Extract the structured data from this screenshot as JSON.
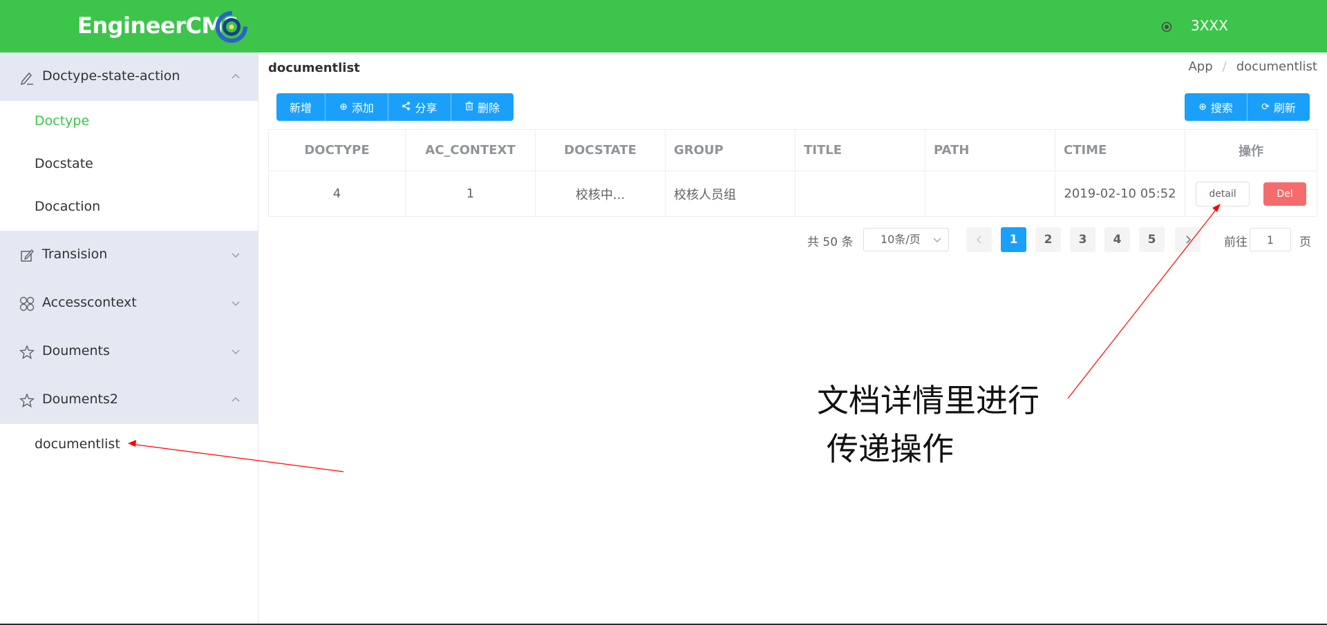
{
  "header": {
    "app_name": "EngineerCMS",
    "user_name": "3XXX",
    "brand_color": "#3cc54a"
  },
  "sidebar": {
    "groups": [
      {
        "label": "Doctype-state-action",
        "icon": "edit-pen-icon",
        "expanded": true
      },
      {
        "label": "Transision",
        "icon": "edit-square-icon",
        "expanded": false
      },
      {
        "label": "Accesscontext",
        "icon": "grid-circles-icon",
        "expanded": false
      },
      {
        "label": "Douments",
        "icon": "star-icon",
        "expanded": false
      },
      {
        "label": "Douments2",
        "icon": "star-icon",
        "expanded": true
      }
    ],
    "items_group1": [
      {
        "label": "Doctype",
        "active": true
      },
      {
        "label": "Docstate",
        "active": false
      },
      {
        "label": "Docaction",
        "active": false
      }
    ],
    "items_group5": [
      {
        "label": "documentlist",
        "active": false
      }
    ]
  },
  "main": {
    "title": "documentlist",
    "breadcrumb": [
      "App",
      "documentlist"
    ],
    "toolbar_left": [
      "新增",
      "添加",
      "分享",
      "删除"
    ],
    "toolbar_right": [
      "搜索",
      "刷新"
    ],
    "table": {
      "columns": [
        "DOCTYPE",
        "AC_CONTEXT",
        "DOCSTATE",
        "GROUP",
        "TITLE",
        "PATH",
        "CTIME",
        "操作"
      ],
      "rows": [
        {
          "doctype": "4",
          "ac_context": "1",
          "docstate": "校核中...",
          "group": "校核人员组",
          "title": "",
          "path": "",
          "ctime": "2019-02-10 05:52"
        }
      ],
      "actions": {
        "detail": "detail",
        "del": "Del"
      }
    },
    "pagination": {
      "total": "共 50 条",
      "page_size": "10条/页",
      "pages": [
        "1",
        "2",
        "3",
        "4",
        "5"
      ],
      "current": "1",
      "jump_prefix": "前往",
      "jump_value": "1",
      "jump_suffix": "页"
    }
  },
  "annotation": {
    "line1": "文档详情里进行",
    "line2": "传递操作",
    "arrow_color": "#ff0000"
  }
}
